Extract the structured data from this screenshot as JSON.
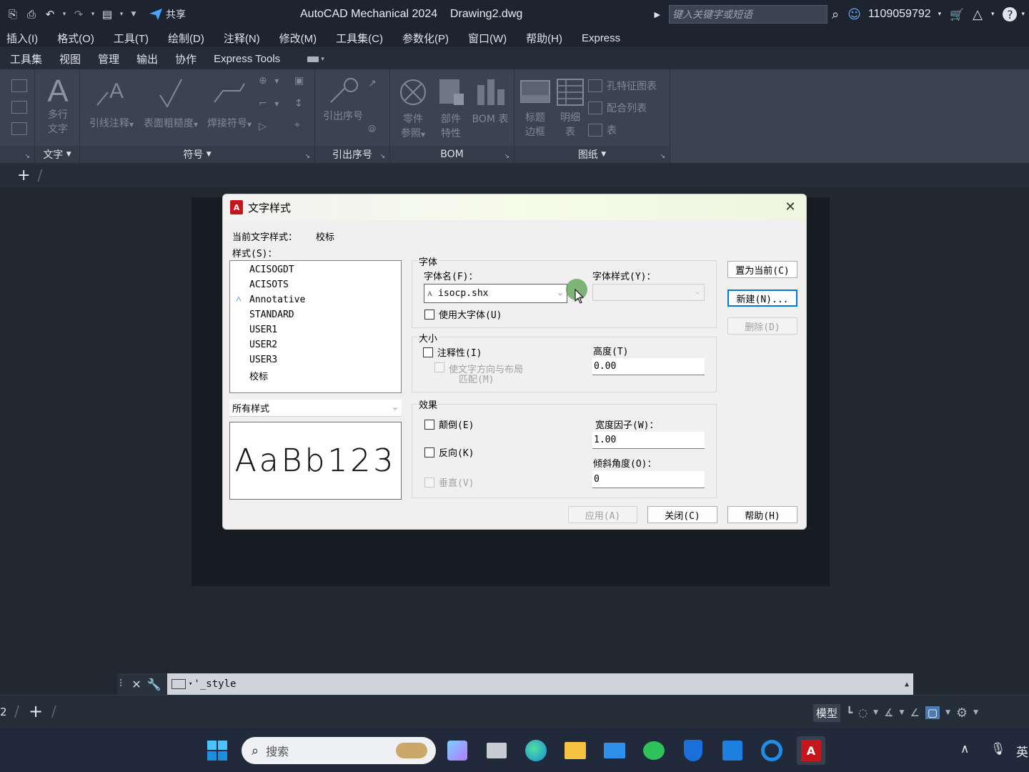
{
  "titlebar": {
    "share_label": "共享",
    "app_title": "AutoCAD Mechanical 2024    Drawing2.dwg",
    "search_placeholder": "键入关键字或短语",
    "user_id": "1109059792"
  },
  "menubar": {
    "items": [
      "插入(I)",
      "格式(O)",
      "工具(T)",
      "绘制(D)",
      "注释(N)",
      "修改(M)",
      "工具集(C)",
      "参数化(P)",
      "窗口(W)",
      "帮助(H)",
      "Express"
    ]
  },
  "ribbon_tabs": [
    "工具集",
    "视图",
    "管理",
    "输出",
    "协作",
    "Express Tools"
  ],
  "ribbon": {
    "text_panel": {
      "label": "文字",
      "mtext_line1": "多行",
      "mtext_line2": "文字"
    },
    "symbol_panel": {
      "label": "符号",
      "leader_note": "引线注释",
      "surface_texture": "表面粗糙度",
      "weld_symbol": "焊接符号"
    },
    "balloon_panel": {
      "label": "引出序号",
      "balloon": "引出序号"
    },
    "bom_panel": {
      "label": "BOM",
      "part_ref_line1": "零件",
      "part_ref_line2": "参照",
      "part_prop_line1": "部件",
      "part_prop_line2": "特性",
      "bom_table": "BOM 表"
    },
    "drawing_panel": {
      "label": "图纸",
      "title_block_line1": "标题",
      "title_block_line2": "边框",
      "parts_list_line1": "明细",
      "parts_list_line2": "表",
      "hole_chart": "孔特征图表",
      "fits_list": "配合列表",
      "table": "表"
    }
  },
  "dialog": {
    "title": "文字样式",
    "current_style_label": "当前文字样式：",
    "current_style_value": "校标",
    "styles_label": "样式(S)：",
    "styles": [
      "ACISOGDT",
      "ACISOTS",
      "Annotative",
      "STANDARD",
      "USER1",
      "USER2",
      "USER3",
      "校标"
    ],
    "filter_value": "所有样式",
    "preview_text": "AaBb123",
    "font_group": "字体",
    "font_name_label": "字体名(F)：",
    "font_name_value": "isocp.shx",
    "font_style_label": "字体样式(Y)：",
    "big_font_label": "使用大字体(U)",
    "size_group": "大小",
    "annotative_label": "注释性(I)",
    "match_layout_line1": "使文字方向与布局",
    "match_layout_line2": "匹配(M)",
    "height_label": "高度(T)",
    "height_value": "0.00",
    "effects_group": "效果",
    "upside_down_label": "颠倒(E)",
    "backwards_label": "反向(K)",
    "vertical_label": "垂直(V)",
    "width_factor_label": "宽度因子(W)：",
    "width_factor_value": "1.00",
    "oblique_label": "倾斜角度(O)：",
    "oblique_value": "0",
    "set_current_btn": "置为当前(C)",
    "new_btn": "新建(N)...",
    "delete_btn": "删除(D)",
    "apply_btn": "应用(A)",
    "close_btn": "关闭(C)",
    "help_btn": "帮助(H)"
  },
  "command_line": {
    "text": "'_style"
  },
  "statusbar": {
    "layout_number": "2",
    "model_label": "模型"
  },
  "taskbar": {
    "search_placeholder": "搜索",
    "ime_label": "英"
  }
}
